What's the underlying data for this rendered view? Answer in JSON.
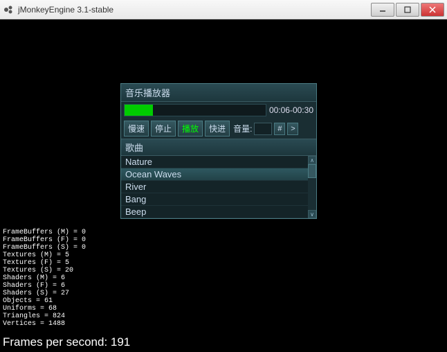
{
  "window": {
    "title": "jMonkeyEngine 3.1-stable"
  },
  "player": {
    "title": "音乐播放器",
    "time": "00:06-00:30",
    "progress_percent": 20,
    "buttons": {
      "slow": "慢速",
      "stop": "停止",
      "play": "播放",
      "fast": "快进"
    },
    "volume_label": "音量:",
    "volume_value": "",
    "hash_btn": "#",
    "gt_btn": ">",
    "songs_title": "歌曲",
    "songs": [
      "Nature",
      "Ocean Waves",
      "River",
      "Bang",
      "Beep"
    ],
    "selected_index": 1
  },
  "stats_text": "FrameBuffers (M) = 0\nFrameBuffers (F) = 0\nFrameBuffers (S) = 0\nTextures (M) = 5\nTextures (F) = 5\nTextures (S) = 20\nShaders (M) = 6\nShaders (F) = 6\nShaders (S) = 27\nObjects = 61\nUniforms = 68\nTriangles = 824\nVertices = 1488",
  "fps": "Frames per second: 191"
}
